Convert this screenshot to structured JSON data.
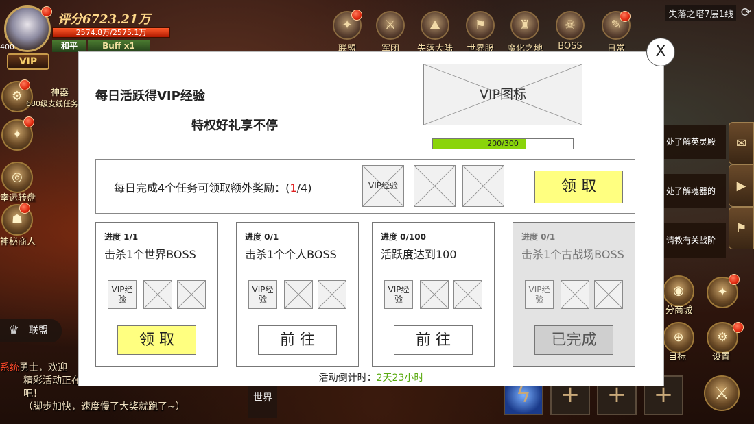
{
  "hud": {
    "score": "评分6723.21万",
    "hp": "2574.8万/2575.1万",
    "level": "400",
    "vip": "VIP",
    "mode": "和平",
    "buff": "Buff x1",
    "location": "失落之塔7层1线"
  },
  "top_menu": [
    {
      "label": "联盟",
      "icon": "alliance-icon",
      "glyph": "✦"
    },
    {
      "label": "军团",
      "icon": "legion-icon",
      "glyph": "⚔"
    },
    {
      "label": "失落大陆",
      "icon": "lost-continent-icon",
      "glyph": "⛰"
    },
    {
      "label": "世界服",
      "icon": "world-server-icon",
      "glyph": "⚑"
    },
    {
      "label": "魔化之地",
      "icon": "demonized-land-icon",
      "glyph": "♜"
    },
    {
      "label": "BOSS",
      "icon": "boss-icon",
      "glyph": "☠"
    },
    {
      "label": "日常",
      "icon": "daily-icon",
      "glyph": "✎"
    }
  ],
  "left_menu": {
    "artifact": "神器",
    "artifact_sub": "680级支线任务",
    "lucky_wheel": "幸运转盘",
    "mystery_shop": "神秘商人",
    "alliance": "联盟"
  },
  "chat": {
    "tag": "系统",
    "line1": "勇士，欢迎",
    "line2": "精彩活动正在",
    "line3": "吧！",
    "line4": "（脚步加快，速度慢了大奖就跑了~）",
    "world": "世界"
  },
  "right_menu": {
    "quests": [
      "处了解英灵殿",
      "处了解魂器的",
      "请教有关战阶"
    ],
    "shop": "分商城",
    "target": "目标",
    "settings": "设置"
  },
  "modal": {
    "title": "每日活跃得VIP经验",
    "subtitle": "特权好礼享不停",
    "vip_icon": "VIP图标",
    "progress_text": "200/300",
    "progress_value": 0.6667,
    "close": "X",
    "daily_reward": {
      "prefix": "每日完成4个任务可领取额外奖励：(",
      "count": "1",
      "suffix": "/4)",
      "item1": "VIP经验",
      "button": "领 取"
    },
    "tasks": [
      {
        "progress": "进度 1/1",
        "name": "击杀1个世界BOSS",
        "item": "VIP经验",
        "button": "领 取",
        "state": "claim"
      },
      {
        "progress": "进度 0/1",
        "name": "击杀1个个人BOSS",
        "item": "VIP经验",
        "button": "前 往",
        "state": "go"
      },
      {
        "progress": "进度 0/100",
        "name": "活跃度达到100",
        "item": "VIP经验",
        "button": "前 往",
        "state": "go"
      },
      {
        "progress": "进度 0/1",
        "name": "击杀1个古战场BOSS",
        "item": "VIP经验",
        "button": "已完成",
        "state": "done"
      }
    ],
    "countdown_label": "活动倒计时：",
    "countdown_value": "2天23小时"
  },
  "colors": {
    "claim_yellow": "#ffff80",
    "progress_green": "#8ad40a",
    "countdown_green": "#5aaa10",
    "highlight_red": "#e02020"
  }
}
